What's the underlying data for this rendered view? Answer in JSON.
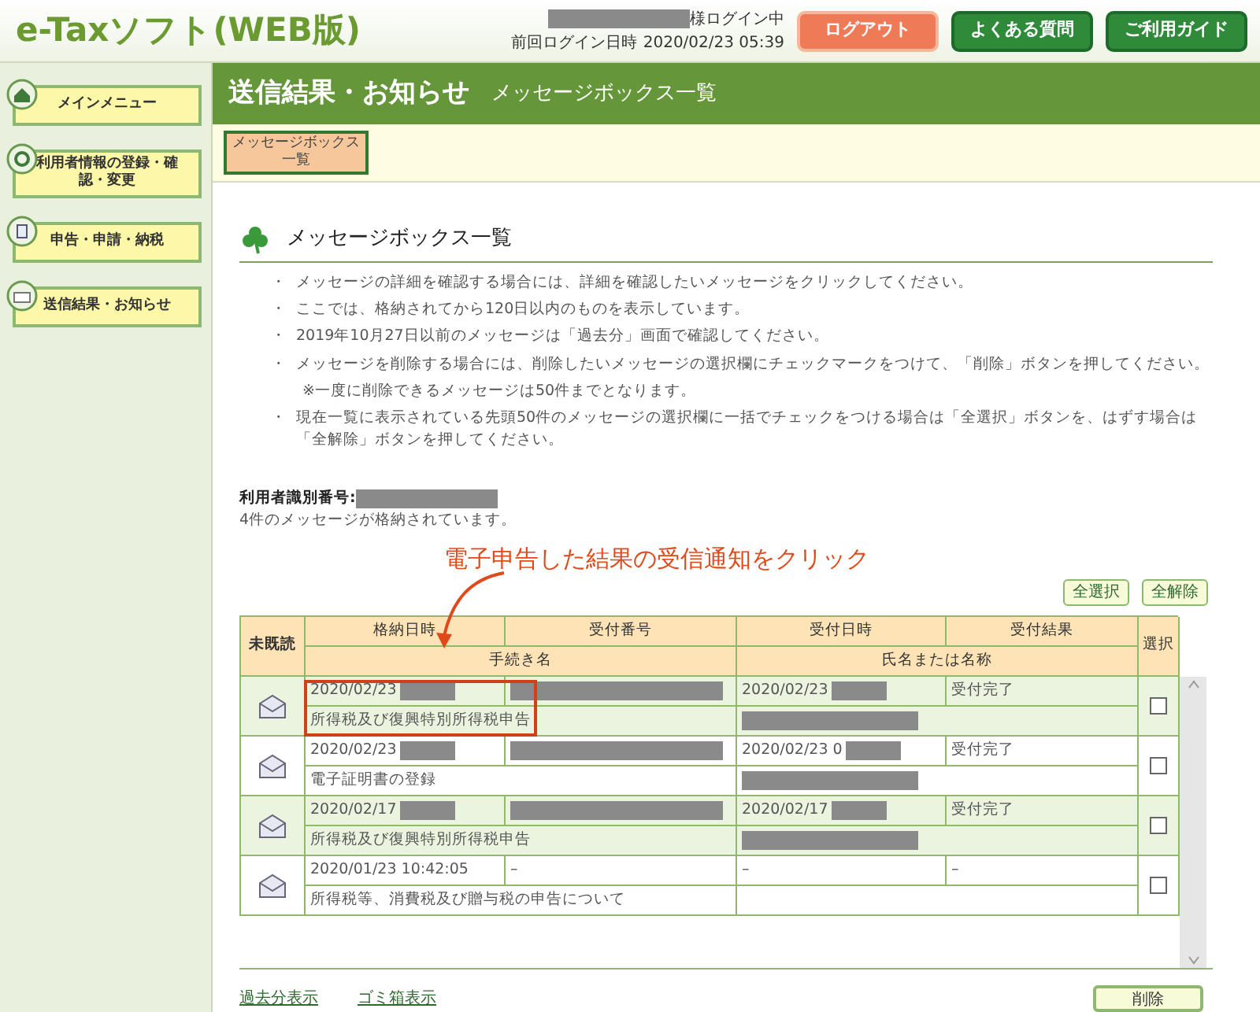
{
  "header": {
    "logo": "e-Taxソフト(WEB版)",
    "login_user_suffix": "様ログイン中",
    "last_login_label": "前回ログイン日時",
    "last_login": "2020/02/23 05:39",
    "buttons": [
      {
        "label": "ログアウト",
        "kind": "logout"
      },
      {
        "label": "よくある質問",
        "kind": "nav"
      },
      {
        "label": "ご利用ガイド",
        "kind": "nav"
      }
    ]
  },
  "sidebar": {
    "items": [
      {
        "label": "メインメニュー",
        "kind": "home"
      },
      {
        "label": "利用者情報の登録・確認・変更",
        "kind": "user"
      },
      {
        "label": "申告・申請・納税",
        "kind": "doc"
      },
      {
        "label": "送信結果・お知らせ",
        "kind": "mail"
      }
    ]
  },
  "page_title": {
    "title": "送信結果・お知らせ",
    "subtitle": "メッセージボックス一覧"
  },
  "subnav": [
    {
      "label": "メッセージボックス一覧",
      "selected": true
    }
  ],
  "section_title": "メッセージボックス一覧",
  "notes": [
    {
      "bullet": "・",
      "text": "メッセージの詳細を確認する場合には、詳細を確認したいメッセージをクリックしてください。"
    },
    {
      "bullet": "・",
      "text": "ここでは、格納されてから120日以内のものを表示しています。"
    },
    {
      "bullet": "・",
      "text": "2019年10月27日以前のメッセージは「過去分」画面で確認してください。"
    },
    {
      "bullet": "・",
      "text": "メッセージを削除する場合には、削除したいメッセージの選択欄にチェックマークをつけて、「削除」ボタンを押してください。",
      "sub": "※一度に削除できるメッセージは50件までとなります。"
    },
    {
      "bullet": "・",
      "text": "現在一覧に表示されている先頭50件のメッセージの選択欄に一括でチェックをつける場合は「全選択」ボタンを、はずす場合は「全解除」ボタンを押してください。"
    }
  ],
  "user_id_label": "利用者識別番号:",
  "count_text": "4件のメッセージが格納されています。",
  "annotation": "電子申告した結果の受信通知をクリック",
  "select_buttons": [
    "全選択",
    "全解除"
  ],
  "table": {
    "columns": {
      "unread": "未既読",
      "stored": "格納日時",
      "receipt_no": "受付番号",
      "received": "受付日時",
      "result": "受付結果",
      "procedure": "手続き名",
      "name": "氏名または名称",
      "select": "選択"
    },
    "rows": [
      {
        "shaded": true,
        "highlighted": true,
        "checked": false,
        "stored": {
          "text": "2020/02/23",
          "hidden": true
        },
        "receipt_no": {
          "hidden": true
        },
        "received": {
          "text": "2020/02/23",
          "hidden": true
        },
        "result": {
          "text": "受付完了"
        },
        "procedure": {
          "text": "所得税及び復興特別所得税申告"
        },
        "name": {
          "hidden": true
        }
      },
      {
        "shaded": false,
        "highlighted": false,
        "checked": false,
        "stored": {
          "text": "2020/02/23",
          "hidden": true
        },
        "receipt_no": {
          "hidden": true
        },
        "received": {
          "text": "2020/02/23 0",
          "hidden": true
        },
        "result": {
          "text": "受付完了"
        },
        "procedure": {
          "text": "電子証明書の登録"
        },
        "name": {
          "hidden": true
        }
      },
      {
        "shaded": true,
        "highlighted": false,
        "checked": false,
        "stored": {
          "text": "2020/02/17",
          "hidden": true
        },
        "receipt_no": {
          "hidden": true
        },
        "received": {
          "text": "2020/02/17",
          "hidden": true
        },
        "result": {
          "text": "受付完了"
        },
        "procedure": {
          "text": "所得税及び復興特別所得税申告"
        },
        "name": {
          "hidden": true
        }
      },
      {
        "shaded": false,
        "highlighted": false,
        "checked": false,
        "stored": {
          "text": "2020/01/23 10:42:05"
        },
        "receipt_no": {
          "text": "–"
        },
        "received": {
          "text": "–"
        },
        "result": {
          "text": "–"
        },
        "procedure": {
          "text": "所得税等、消費税及び贈与税の申告について"
        },
        "name": {}
      }
    ]
  },
  "footer_links": [
    "過去分表示",
    "ゴミ箱表示"
  ],
  "delete_button": "削除"
}
